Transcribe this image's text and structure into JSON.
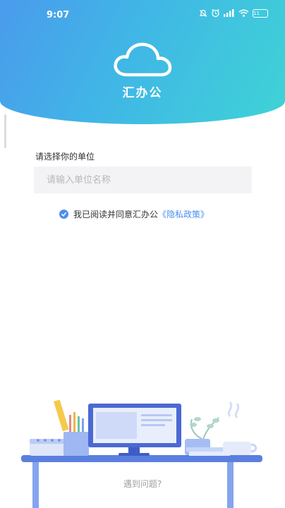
{
  "status_bar": {
    "time": "9:07",
    "icons": [
      "mute-icon",
      "alarm-icon",
      "signal-icon",
      "wifi-icon",
      "battery-icon"
    ],
    "battery_level": "11"
  },
  "header": {
    "logo_icon": "cloud-icon",
    "app_name": "汇办公",
    "gradient_colors": [
      "#4a9bec",
      "#3fd3d6"
    ]
  },
  "form": {
    "unit_label": "请选择你的单位",
    "unit_placeholder": "请输入单位名称",
    "unit_value": "",
    "agreement": {
      "checked": true,
      "text": "我已阅读并同意汇办公",
      "link_text": "《隐私政策》",
      "link_color": "#4a8ff0"
    }
  },
  "footer": {
    "help_text": "遇到问题?"
  }
}
